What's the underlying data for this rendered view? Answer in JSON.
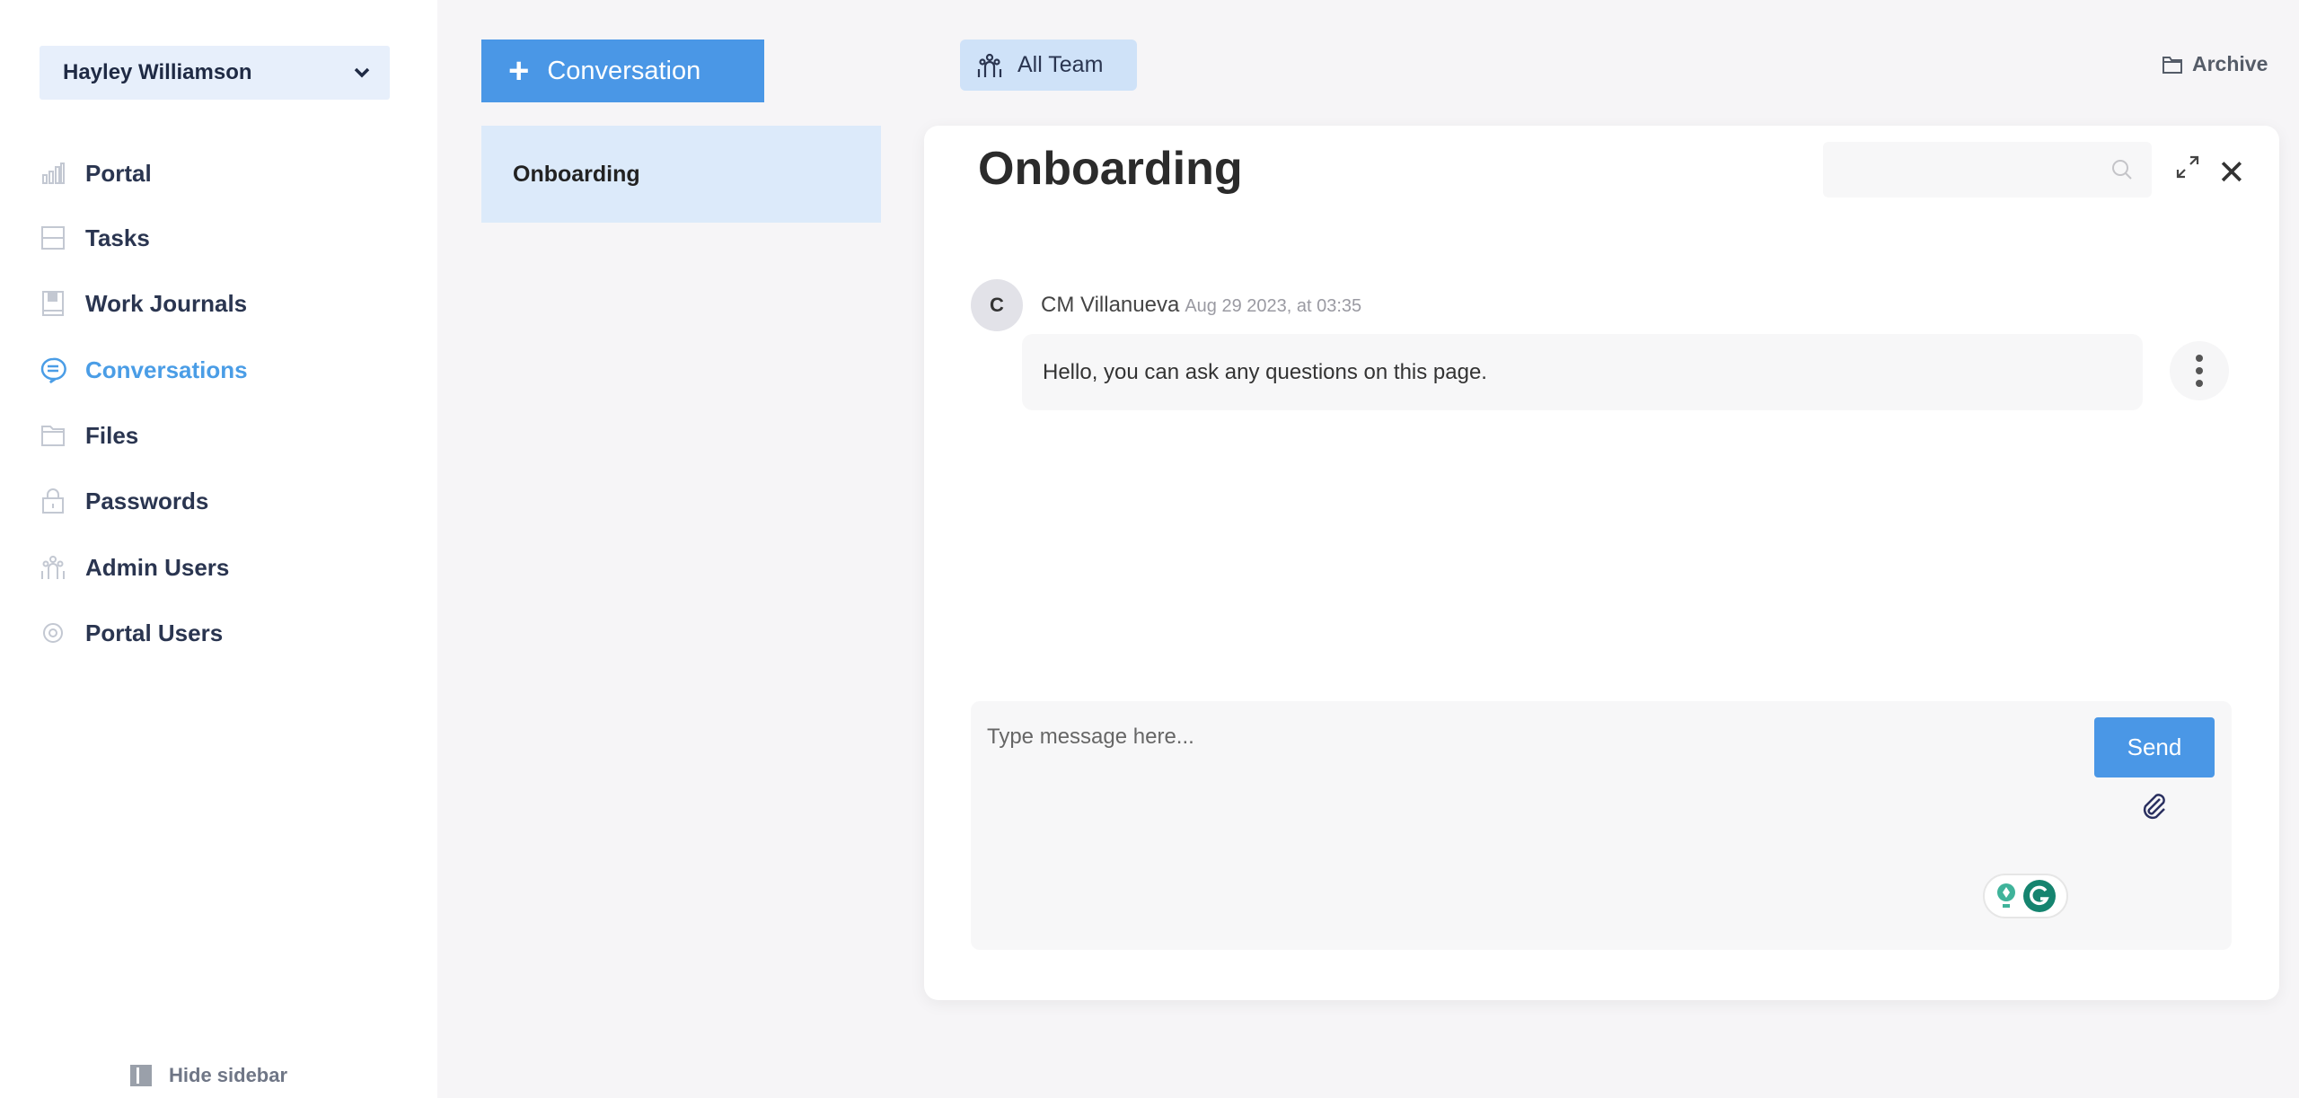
{
  "sidebar": {
    "user": "Hayley Williamson",
    "items": [
      {
        "label": "Portal",
        "icon": "bar-chart-icon"
      },
      {
        "label": "Tasks",
        "icon": "tasks-icon"
      },
      {
        "label": "Work Journals",
        "icon": "journal-icon"
      },
      {
        "label": "Conversations",
        "icon": "chat-icon",
        "active": true
      },
      {
        "label": "Files",
        "icon": "folder-icon"
      },
      {
        "label": "Passwords",
        "icon": "lock-icon"
      },
      {
        "label": "Admin Users",
        "icon": "users-icon"
      },
      {
        "label": "Portal Users",
        "icon": "gear-icon"
      }
    ],
    "hide_label": "Hide sidebar"
  },
  "conversations": {
    "new_label": "Conversation",
    "items": [
      {
        "label": "Onboarding",
        "selected": true
      }
    ]
  },
  "header": {
    "team_filter": "All Team",
    "archive_label": "Archive"
  },
  "panel": {
    "title": "Onboarding",
    "search_placeholder": "",
    "messages": [
      {
        "avatar": "C",
        "author": "CM Villanueva",
        "time": "Aug 29 2023, at 03:35",
        "text": "Hello, you can ask any questions on this page."
      }
    ],
    "composer": {
      "placeholder": "Type message here...",
      "value": "",
      "send_label": "Send"
    }
  },
  "colors": {
    "accent": "#4a97e6",
    "active_nav": "#4a9de6",
    "selected_bg": "#dceafa",
    "grammarly": "#15846f"
  }
}
